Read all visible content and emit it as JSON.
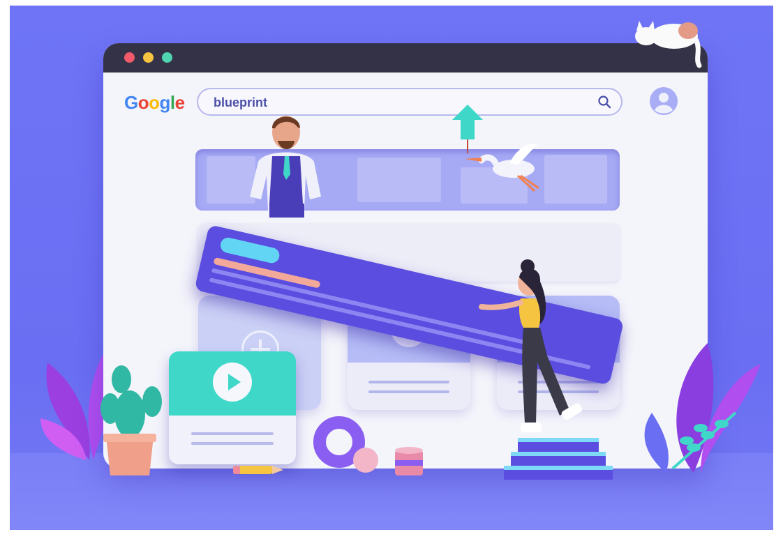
{
  "window": {
    "controls": [
      "close",
      "minimize",
      "maximize"
    ],
    "control_colors": [
      "#f25a6b",
      "#f5c542",
      "#4fd6b0"
    ],
    "titlebar_color": "#343246"
  },
  "header": {
    "logo_letters": [
      "G",
      "o",
      "o",
      "g",
      "l",
      "e"
    ],
    "search": {
      "value": "blueprint",
      "icon": "search-icon"
    },
    "profile_icon": "user-avatar-icon"
  },
  "cards": {
    "add_icon": "plus-circle-icon",
    "video_icon": "play-icon"
  },
  "colors": {
    "background": "#6f74f6",
    "accent_purple": "#5a4de0",
    "teal": "#3fd8c8",
    "light_blue": "#63d5f4"
  }
}
